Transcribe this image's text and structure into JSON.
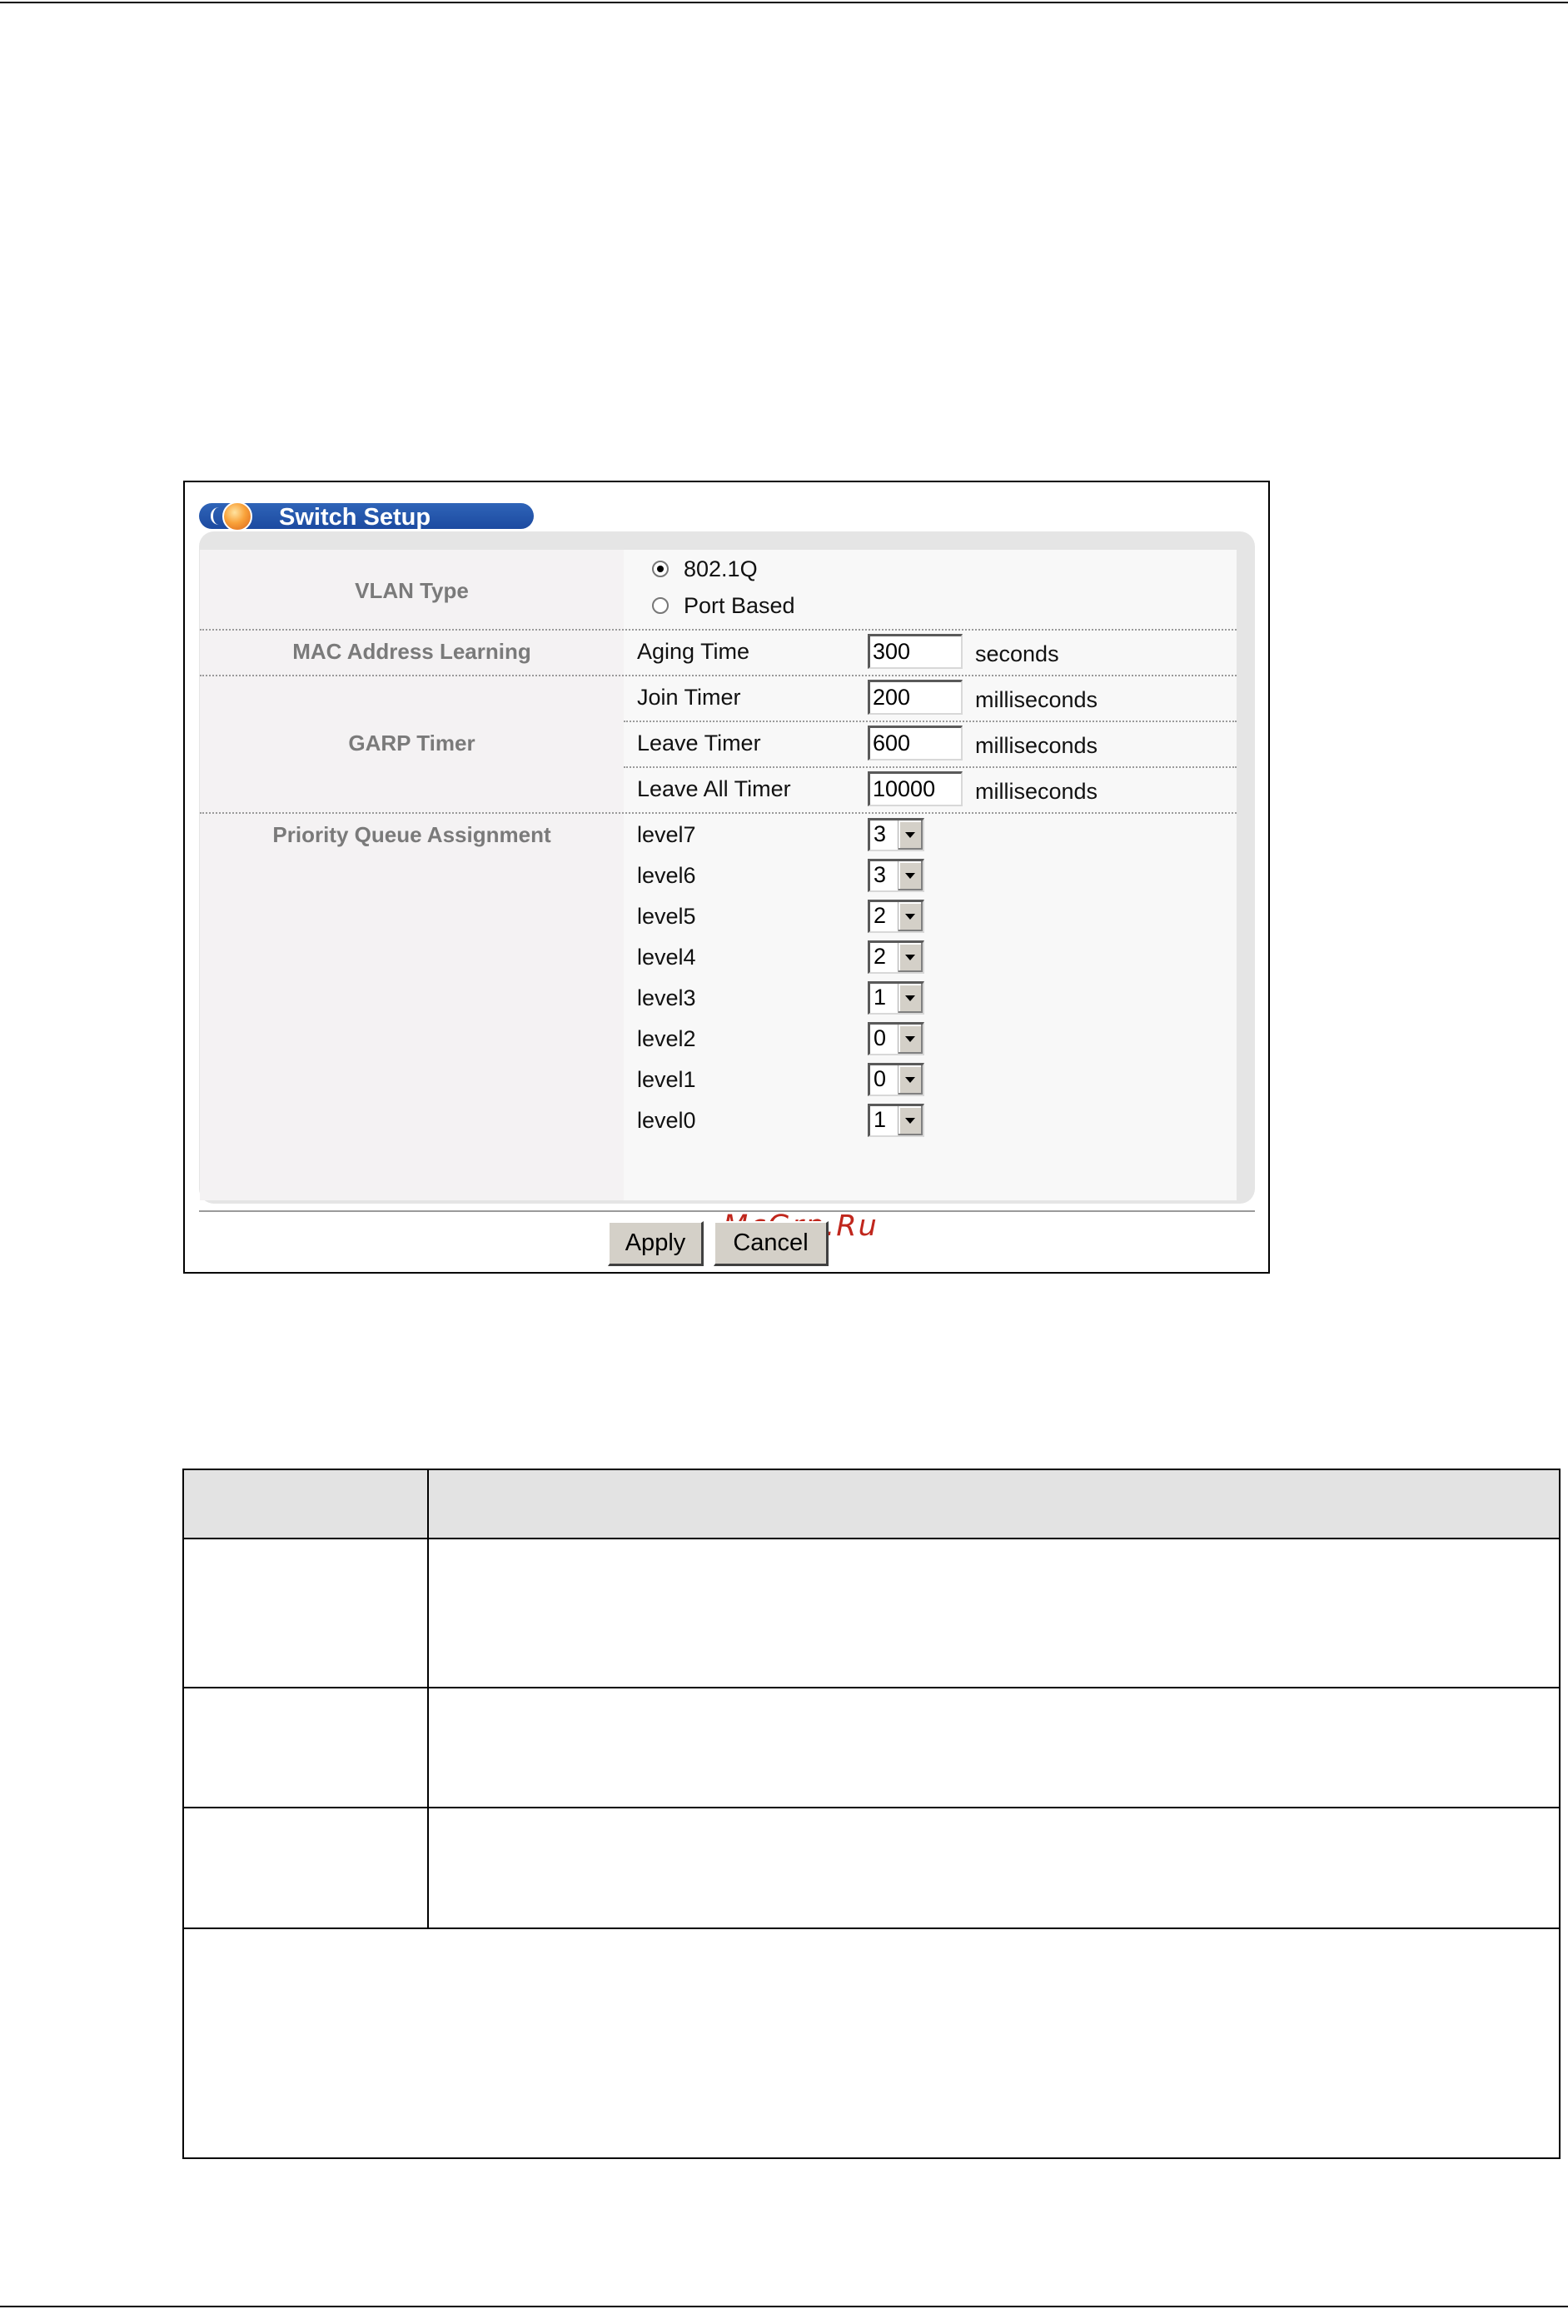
{
  "switch_setup": {
    "title": "Switch Setup",
    "vlan_type": {
      "label": "VLAN Type",
      "options": [
        "802.1Q",
        "Port Based"
      ],
      "selected": "802.1Q"
    },
    "mac_learning": {
      "label": "MAC Address Learning",
      "aging_label": "Aging Time",
      "aging_value": "300",
      "aging_unit": "seconds"
    },
    "garp": {
      "label": "GARP Timer",
      "join_label": "Join Timer",
      "join_value": "200",
      "leave_label": "Leave Timer",
      "leave_value": "600",
      "leave_all_label": "Leave All Timer",
      "leave_all_value": "10000",
      "unit": "milliseconds"
    },
    "priority_queue": {
      "label": "Priority Queue Assignment",
      "levels": [
        {
          "label": "level7",
          "value": "3"
        },
        {
          "label": "level6",
          "value": "3"
        },
        {
          "label": "level5",
          "value": "2"
        },
        {
          "label": "level4",
          "value": "2"
        },
        {
          "label": "level3",
          "value": "1"
        },
        {
          "label": "level2",
          "value": "0"
        },
        {
          "label": "level1",
          "value": "0"
        },
        {
          "label": "level0",
          "value": "1"
        }
      ]
    },
    "watermark": "McGrp.Ru",
    "buttons": {
      "apply": "Apply",
      "cancel": "Cancel"
    }
  }
}
